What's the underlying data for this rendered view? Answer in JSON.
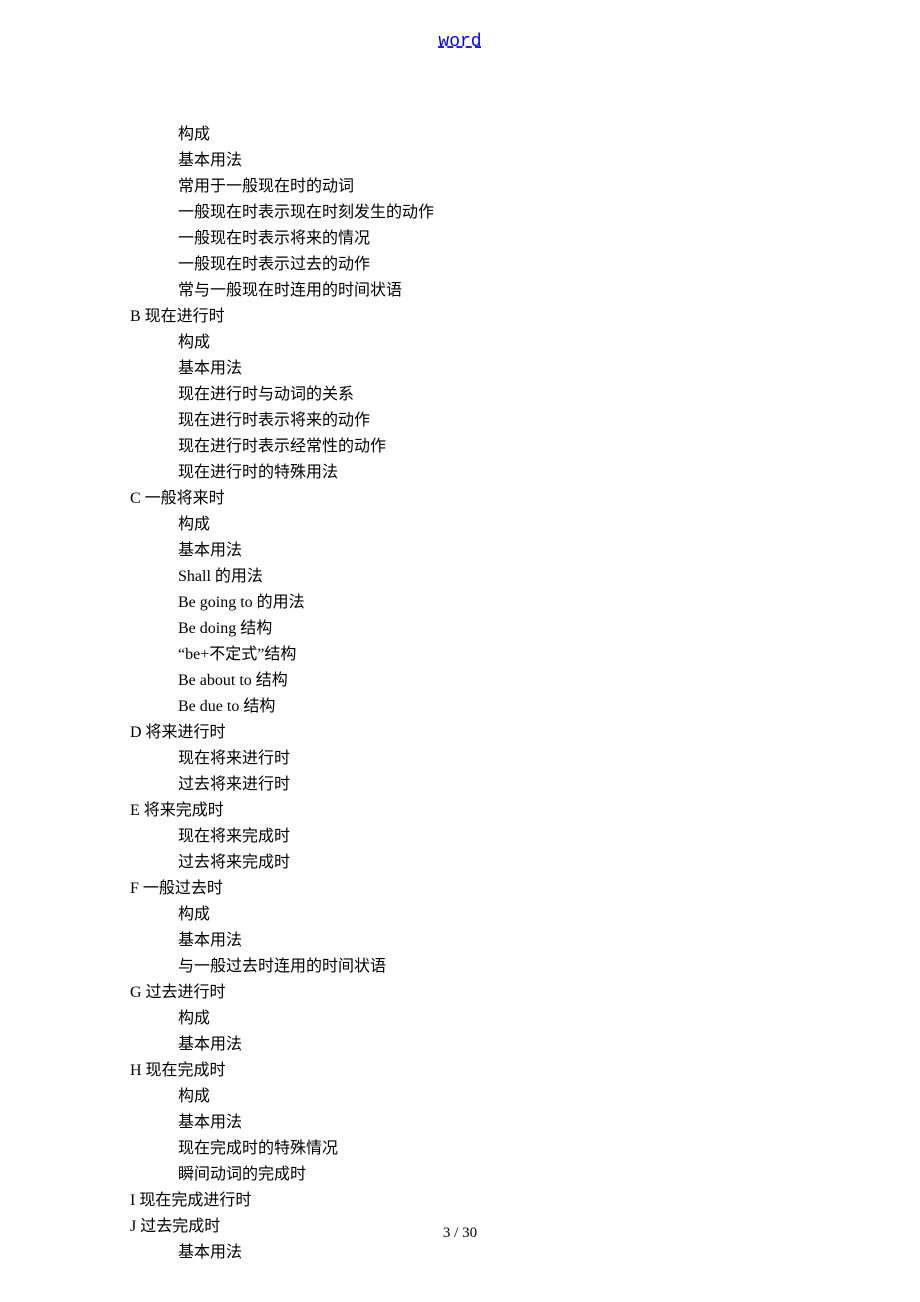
{
  "header": {
    "title": "word"
  },
  "outline": [
    {
      "level": 1,
      "text": "构成"
    },
    {
      "level": 1,
      "text": "基本用法"
    },
    {
      "level": 1,
      "text": "常用于一般现在时的动词"
    },
    {
      "level": 1,
      "text": "一般现在时表示现在时刻发生的动作"
    },
    {
      "level": 1,
      "text": "一般现在时表示将来的情况"
    },
    {
      "level": 1,
      "text": "一般现在时表示过去的动作"
    },
    {
      "level": 1,
      "text": "常与一般现在时连用的时间状语"
    },
    {
      "level": 0,
      "text": "B 现在进行时"
    },
    {
      "level": 1,
      "text": "构成"
    },
    {
      "level": 1,
      "text": "基本用法"
    },
    {
      "level": 1,
      "text": "现在进行时与动词的关系"
    },
    {
      "level": 1,
      "text": "现在进行时表示将来的动作"
    },
    {
      "level": 1,
      "text": "现在进行时表示经常性的动作"
    },
    {
      "level": 1,
      "text": "现在进行时的特殊用法"
    },
    {
      "level": 0,
      "text": "C 一般将来时"
    },
    {
      "level": 1,
      "text": "构成"
    },
    {
      "level": 1,
      "text": "基本用法"
    },
    {
      "level": 1,
      "text": "Shall 的用法"
    },
    {
      "level": 1,
      "text": "Be going to 的用法"
    },
    {
      "level": 1,
      "text": "Be doing 结构"
    },
    {
      "level": 1,
      "text": "“be+不定式”结构"
    },
    {
      "level": 1,
      "text": "Be about to 结构"
    },
    {
      "level": 1,
      "text": "Be due to 结构"
    },
    {
      "level": 0,
      "text": "D 将来进行时"
    },
    {
      "level": 1,
      "text": "现在将来进行时"
    },
    {
      "level": 1,
      "text": "过去将来进行时"
    },
    {
      "level": 0,
      "text": "E 将来完成时"
    },
    {
      "level": 1,
      "text": "现在将来完成时"
    },
    {
      "level": 1,
      "text": "过去将来完成时"
    },
    {
      "level": 0,
      "text": "F 一般过去时"
    },
    {
      "level": 1,
      "text": "构成"
    },
    {
      "level": 1,
      "text": "基本用法"
    },
    {
      "level": 1,
      "text": "与一般过去时连用的时间状语"
    },
    {
      "level": 0,
      "text": "G 过去进行时"
    },
    {
      "level": 1,
      "text": "构成"
    },
    {
      "level": 1,
      "text": "基本用法"
    },
    {
      "level": 0,
      "text": "H 现在完成时"
    },
    {
      "level": 1,
      "text": "构成"
    },
    {
      "level": 1,
      "text": "基本用法"
    },
    {
      "level": 1,
      "text": "现在完成时的特殊情况"
    },
    {
      "level": 1,
      "text": "瞬间动词的完成时"
    },
    {
      "level": 0,
      "text": "I 现在完成进行时"
    },
    {
      "level": 0,
      "text": "J 过去完成时"
    },
    {
      "level": 1,
      "text": "基本用法"
    }
  ],
  "footer": {
    "page_number": "3 / 30"
  }
}
